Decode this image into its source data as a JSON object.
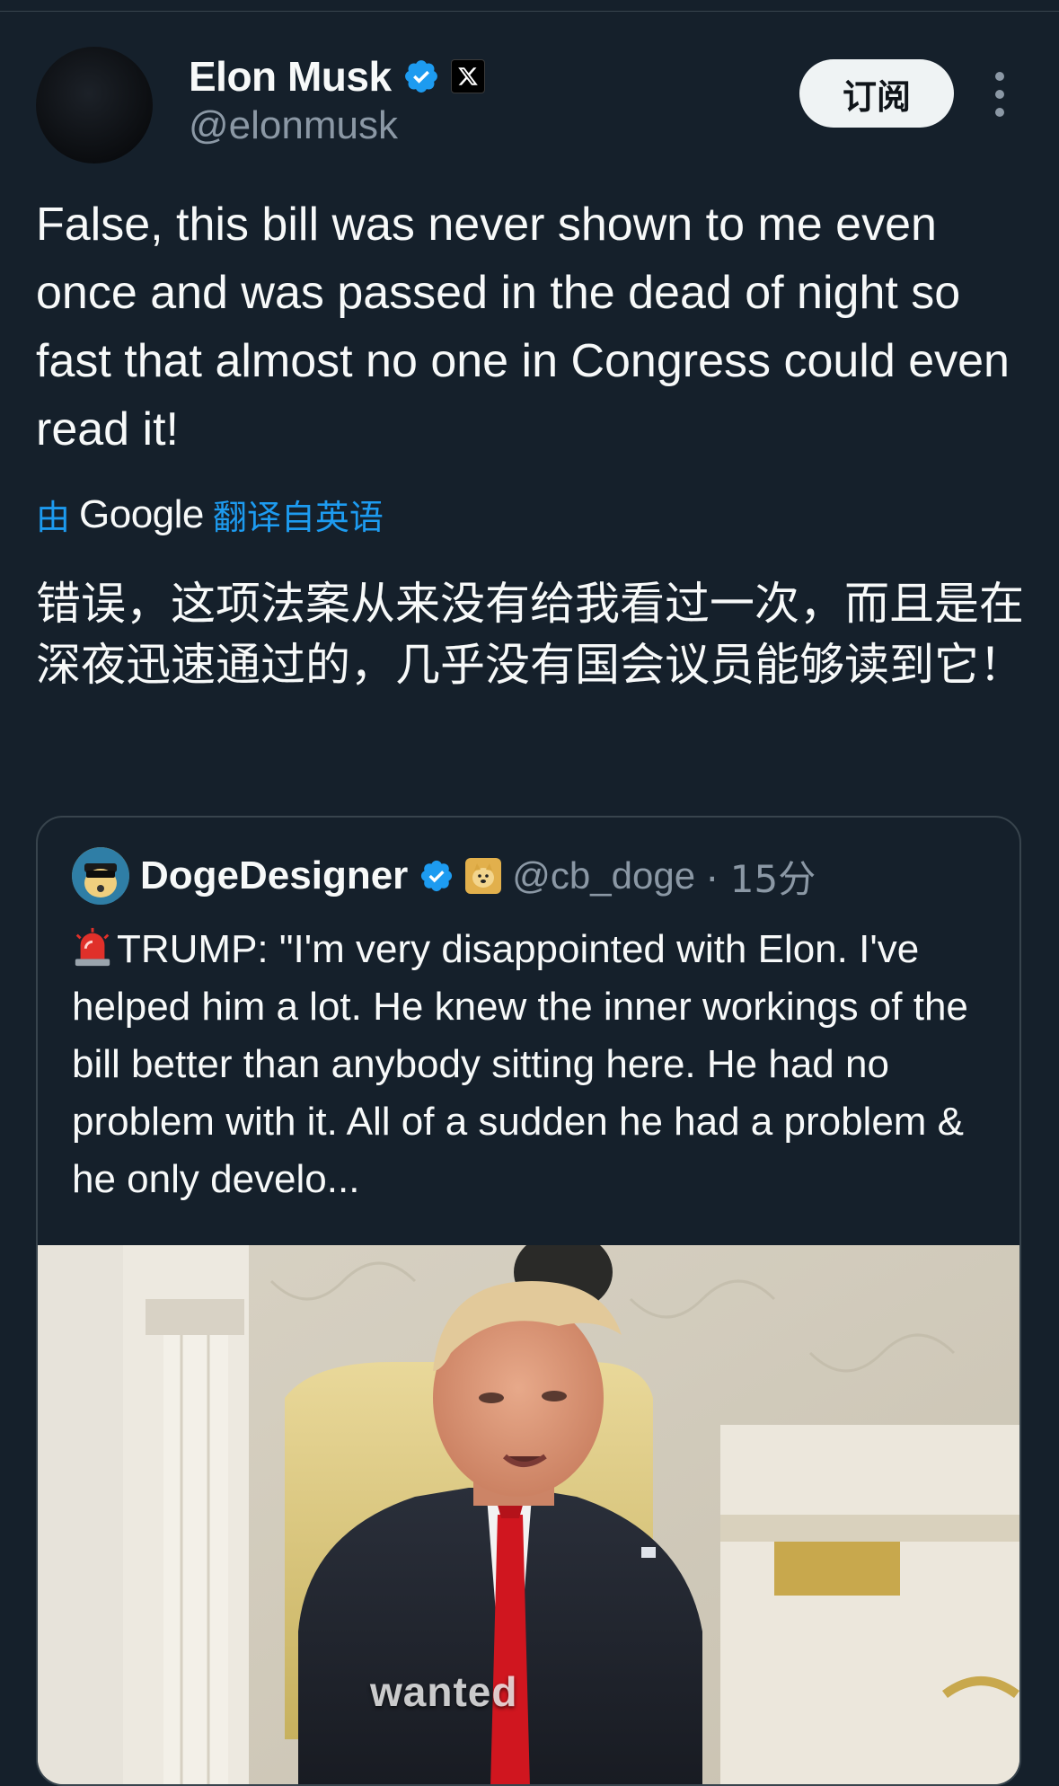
{
  "author": {
    "name": "Elon Musk",
    "handle": "@elonmusk",
    "verified": true,
    "avatar_icon": "avatar-dark"
  },
  "subscribe_label": "订阅",
  "tweet": {
    "text": "False, this bill was never shown to me even once and was passed in the dead of night so fast that almost no one in Congress could even read it!",
    "translation": {
      "prefix": "由",
      "provider": "Google",
      "suffix": "翻译自英语",
      "text": "错误，这项法案从来没有给我看过一次，而且是在深夜迅速通过的，几乎没有国会议员能够读到它！"
    }
  },
  "quoted_tweet": {
    "author_name": "DogeDesigner",
    "handle": "@cb_doge",
    "time": "· 15分",
    "text": "TRUMP: \"I'm very disappointed with Elon. I've helped him a lot. He knew the inner workings of the bill better than anybody sitting here. He had no problem with it. All of a sudden he had a problem & he only develo...",
    "media_caption": "wanted"
  },
  "colors": {
    "background": "#15202b",
    "accent": "#1d9bf0",
    "secondary_text": "#8b98a5",
    "border": "#38444d"
  }
}
